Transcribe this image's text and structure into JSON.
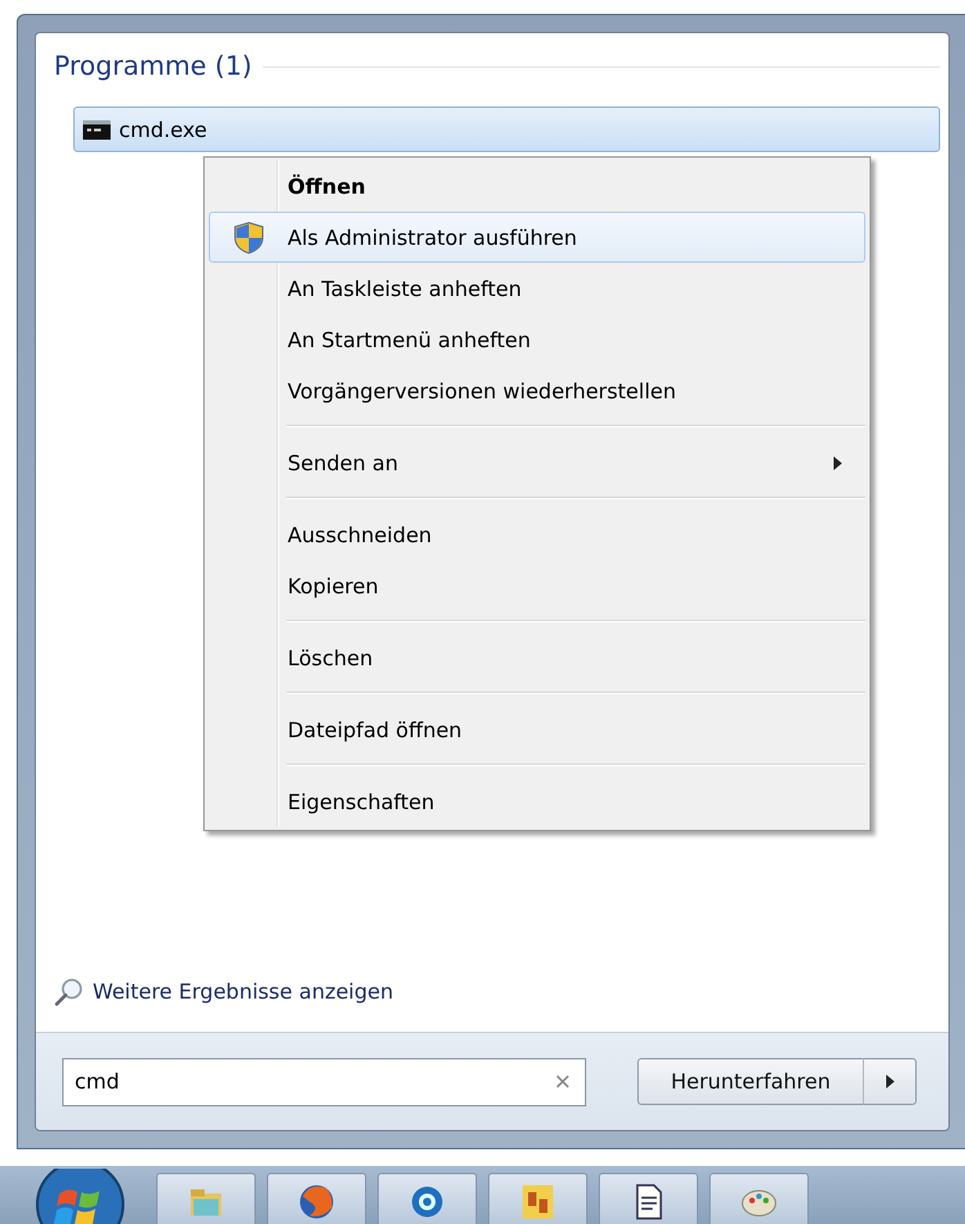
{
  "results": {
    "title": "Programme (1)",
    "items": [
      {
        "label": "cmd.exe",
        "selected": true
      }
    ]
  },
  "context_menu": {
    "groups": [
      [
        {
          "label": "Öffnen",
          "kind": "plain",
          "default": true,
          "selected": false,
          "submenu": false
        },
        {
          "label": "Als Administrator ausführen",
          "kind": "elevated",
          "default": false,
          "selected": true,
          "submenu": false
        },
        {
          "label": "An Taskleiste anheften",
          "kind": "plain",
          "default": false,
          "selected": false,
          "submenu": false
        },
        {
          "label": "An Startmenü anheften",
          "kind": "plain",
          "default": false,
          "selected": false,
          "submenu": false
        },
        {
          "label": "Vorgängerversionen wiederherstellen",
          "kind": "plain",
          "default": false,
          "selected": false,
          "submenu": false
        }
      ],
      [
        {
          "label": "Senden an",
          "kind": "plain",
          "default": false,
          "selected": false,
          "submenu": true
        }
      ],
      [
        {
          "label": "Ausschneiden",
          "kind": "plain",
          "default": false,
          "selected": false,
          "submenu": false
        },
        {
          "label": "Kopieren",
          "kind": "plain",
          "default": false,
          "selected": false,
          "submenu": false
        }
      ],
      [
        {
          "label": "Löschen",
          "kind": "plain",
          "default": false,
          "selected": false,
          "submenu": false
        }
      ],
      [
        {
          "label": "Dateipfad öffnen",
          "kind": "plain",
          "default": false,
          "selected": false,
          "submenu": false
        }
      ],
      [
        {
          "label": "Eigenschaften",
          "kind": "plain",
          "default": false,
          "selected": false,
          "submenu": false
        }
      ]
    ]
  },
  "more_results_link": "Weitere Ergebnisse anzeigen",
  "search": {
    "value": "cmd"
  },
  "shutdown_button": "Herunterfahren"
}
